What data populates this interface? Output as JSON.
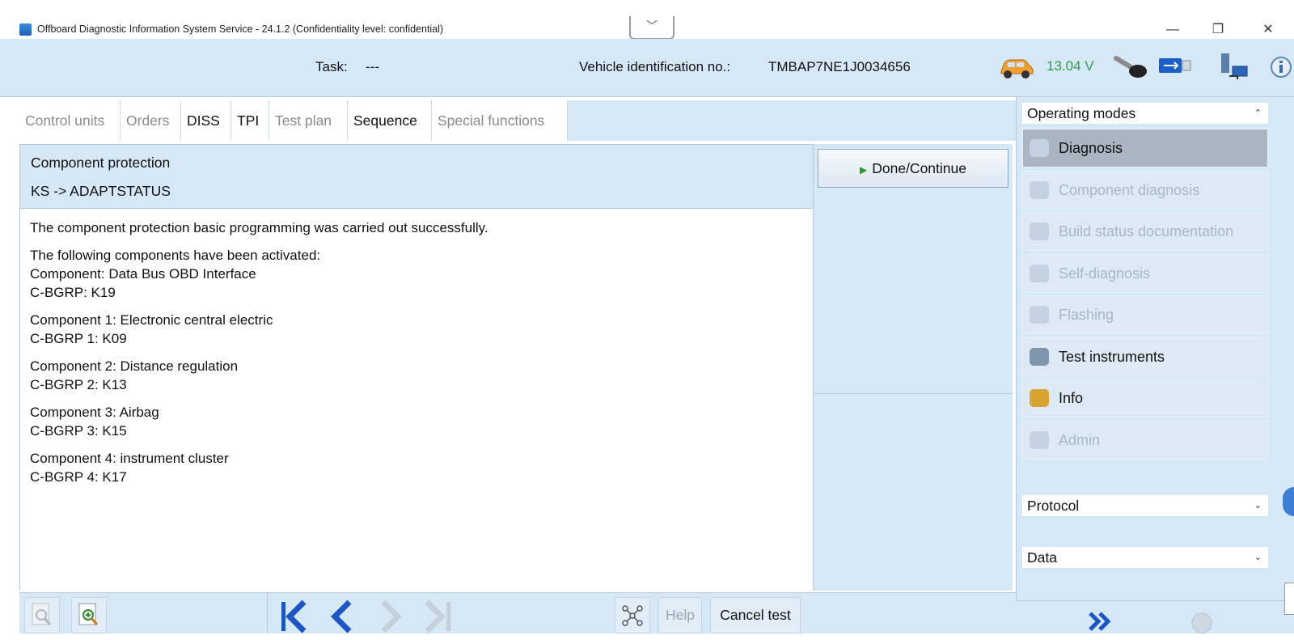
{
  "window": {
    "title": "Offboard Diagnostic Information System Service - 24.1.2 (Confidentiality level: confidential)",
    "dropdown_glyph": "﹀",
    "minimize": "—",
    "restore": "❐",
    "close": "✕"
  },
  "header": {
    "task_label": "Task:",
    "task_value": "---",
    "vin_label": "Vehicle identification no.:",
    "vin_value": "TMBAP7NE1J0034656",
    "voltage": "13.04 V",
    "voltage_color": "#2ea043"
  },
  "tabs": [
    {
      "label": "Control units",
      "active": false
    },
    {
      "label": "Orders",
      "active": false
    },
    {
      "label": "DISS",
      "active": true
    },
    {
      "label": "TPI",
      "active": true
    },
    {
      "label": "Test plan",
      "active": false
    },
    {
      "label": "Sequence",
      "active": true
    },
    {
      "label": "Special functions",
      "active": false
    }
  ],
  "content": {
    "heading": "Component protection",
    "subheading": "KS -> ADAPTSTATUS",
    "paragraphs": [
      [
        "The component protection basic programming was carried out successfully."
      ],
      [
        "The following components have been activated:",
        "Component: Data Bus OBD Interface",
        "C-BGRP: K19"
      ],
      [
        "Component 1: Electronic central electric",
        "C-BGRP 1: K09"
      ],
      [
        "Component 2: Distance regulation",
        "C-BGRP 2: K13"
      ],
      [
        "Component 3: Airbag",
        "C-BGRP 3: K15"
      ],
      [
        "Component 4: instrument cluster",
        "C-BGRP 4: K17"
      ]
    ],
    "done_button": "Done/Continue"
  },
  "toolbar": {
    "help": "Help",
    "cancel": "Cancel test",
    "first": "|<",
    "prev": "<",
    "next": ">",
    "last": ">|"
  },
  "sidebar": {
    "operating_modes": "Operating modes",
    "items": [
      {
        "label": "Diagnosis",
        "state": "selected"
      },
      {
        "label": "Component diagnosis",
        "state": "disabled"
      },
      {
        "label": "Build status documentation",
        "state": "disabled"
      },
      {
        "label": "Self-diagnosis",
        "state": "disabled"
      },
      {
        "label": "Flashing",
        "state": "disabled"
      },
      {
        "label": "Test instruments",
        "state": "enabled"
      },
      {
        "label": "Info",
        "state": "enabled"
      },
      {
        "label": "Admin",
        "state": "disabled"
      }
    ],
    "protocol": "Protocol",
    "data": "Data"
  },
  "colors": {
    "header_bg": "#d6e7f6",
    "nav_blue": "#1a56c4"
  }
}
